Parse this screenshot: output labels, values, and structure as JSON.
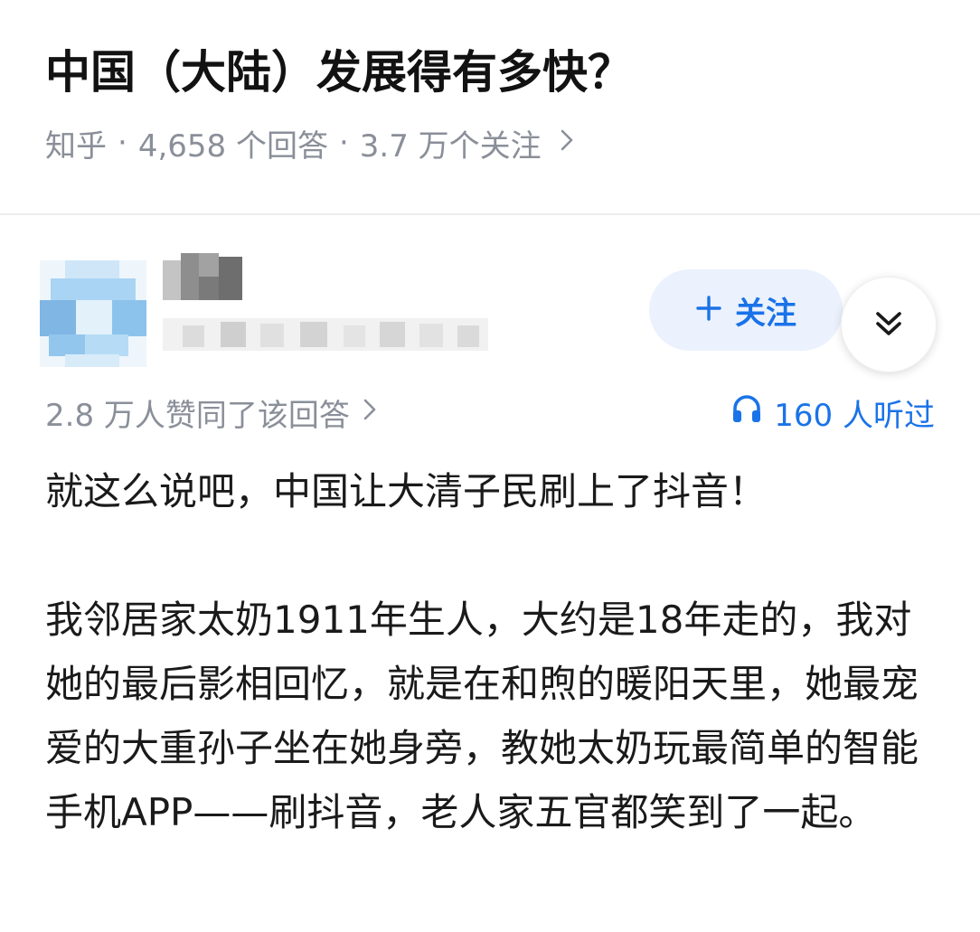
{
  "question": {
    "title": "中国（大陆）发展得有多快？",
    "source": "知乎",
    "separator": "·",
    "answers_count": "4,658 个回答",
    "followers_count": "3.7 万个关注",
    "more_icon": "chevron-right-icon"
  },
  "answer": {
    "author": {
      "name_blurred": true,
      "bio_blurred": true
    },
    "follow_label": "关注",
    "upvote_text": "2.8 万人赞同了该回答",
    "listen_text": "160 人听过",
    "paragraphs": [
      "就这么说吧，中国让大清子民刷上了抖音！",
      "我邻居家太奶1911年生人，大约是18年走的，我对她的最后影相回忆，就是在和煦的暖阳天里，她最宠爱的大重孙子坐在她身旁，教她太奶玩最简单的智能手机APP——刷抖音，老人家五官都笑到了一起。"
    ]
  },
  "colors": {
    "accent": "#1a73e8",
    "follow_bg": "#ebf2fd",
    "meta_text": "#8a8f99",
    "body_text": "#1a1a1a"
  }
}
